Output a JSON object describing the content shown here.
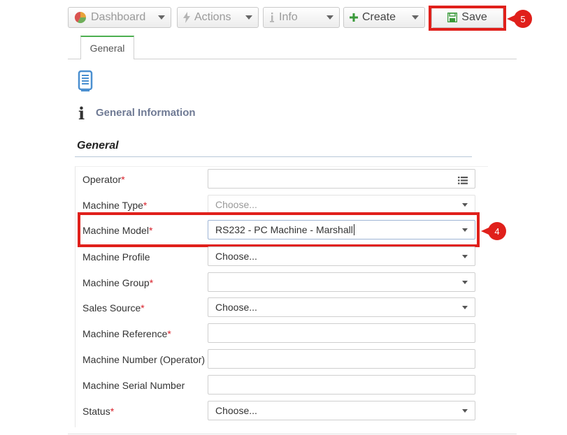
{
  "toolbar": {
    "dashboard": "Dashboard",
    "actions": "Actions",
    "info": "Info",
    "create": "Create",
    "save": "Save"
  },
  "callouts": {
    "save": "5",
    "machine_model": "4"
  },
  "tabs": [
    {
      "label": "General"
    }
  ],
  "section": {
    "title": "General Information"
  },
  "group": {
    "title": "General"
  },
  "form": {
    "operator": {
      "label": "Operator",
      "required": "*",
      "value": ""
    },
    "machine_type": {
      "label": "Machine Type",
      "required": "*",
      "placeholder": "Choose..."
    },
    "machine_model": {
      "label": "Machine Model",
      "required": "*",
      "value": "RS232 - PC Machine - Marshall"
    },
    "machine_profile": {
      "label": "Machine Profile",
      "value": "Choose..."
    },
    "machine_group": {
      "label": "Machine Group",
      "required": "*",
      "value": ""
    },
    "sales_source": {
      "label": "Sales Source",
      "required": "*",
      "value": "Choose..."
    },
    "machine_reference": {
      "label": "Machine Reference",
      "required": "*",
      "value": ""
    },
    "machine_number_operator": {
      "label": "Machine Number (Operator)",
      "value": ""
    },
    "machine_serial_number": {
      "label": "Machine Serial Number",
      "value": ""
    },
    "status": {
      "label": "Status",
      "required": "*",
      "value": "Choose..."
    }
  },
  "colors": {
    "highlight": "#e0201b",
    "tab_accent": "#4caf50",
    "required": "#d9202a",
    "save_icon": "#3a9a3a",
    "create_icon": "#3a9a3a"
  }
}
